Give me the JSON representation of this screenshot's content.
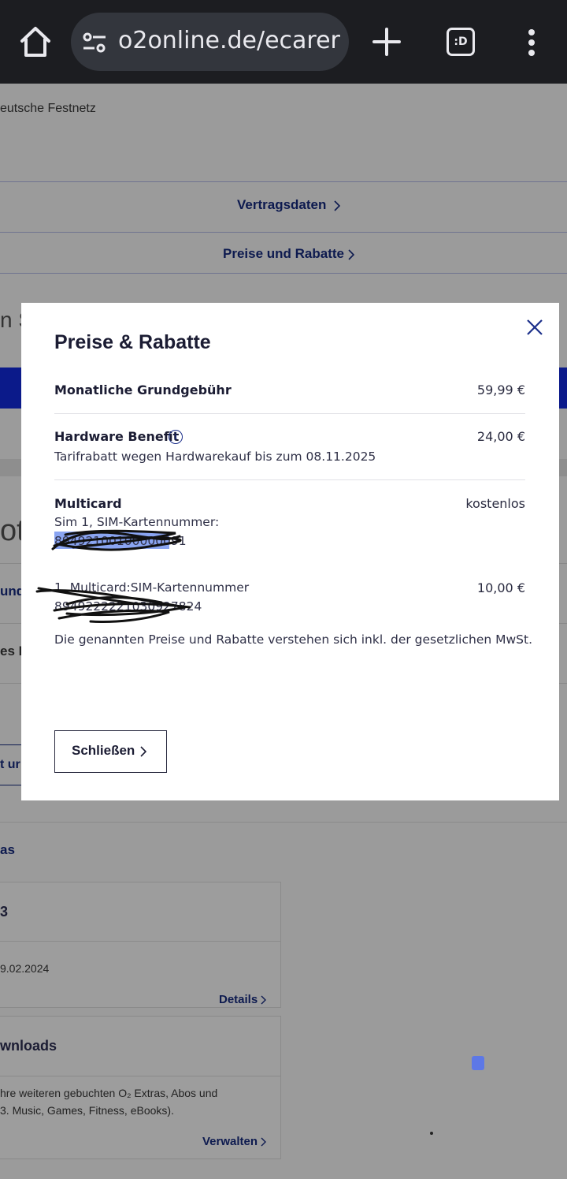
{
  "browser": {
    "url": "o2online.de/ecarer",
    "tabs_badge": ":D",
    "icons": [
      "home-icon",
      "site-settings-icon",
      "new-tab-icon",
      "tab-switcher-icon",
      "more-menu-icon"
    ]
  },
  "background": {
    "festnetz_text": "eutsche Festnetz",
    "nav_vertragsdaten": "Vertragsdaten",
    "nav_preise": "Preise und Rabatte",
    "partial_s": "n S",
    "partial_oti": "oti",
    "partial_und": "und",
    "partial_esd": "es D",
    "partial_tur": "t ur",
    "section_as": "as",
    "card1_title": "3",
    "card1_date": "9.02.2024",
    "card1_link": "Details",
    "card2_title": "wnloads",
    "card2_text_line1": "hre weiteren gebuchten O₂ Extras, Abos und",
    "card2_text_line2": "3. Music, Games, Fitness, eBooks).",
    "card2_link": "Verwalten",
    "colors": {
      "nav_text": "#0d1a4f",
      "band": "#0b1a8a"
    }
  },
  "modal": {
    "title": "Preise & Rabatte",
    "rows": [
      {
        "label": "Monatliche Grundgebühr",
        "price": "59,99 €"
      },
      {
        "label": "Hardware Benefit",
        "price": "24,00 €",
        "sub": "Tarifrabatt wegen Hardwarekauf bis zum 08.11.2025"
      },
      {
        "label": "Multicard",
        "price": "kostenlos",
        "sub": "Sim 1, SIM-Kartennummer:",
        "sim_number": "89492100100000091"
      },
      {
        "sub": "1. Multicard:SIM-Kartennummer",
        "price": "10,00 €",
        "sim_number": "8949222221030927824"
      }
    ],
    "vat_note": "Die genannten Preise und Rabatte verstehen sich inkl. der gesetzlichen MwSt.",
    "close_button": "Schließen",
    "colors": {
      "title": "#1b1c33",
      "info_icon": "#1b2f8a",
      "selection": "#8aa5f2"
    }
  }
}
